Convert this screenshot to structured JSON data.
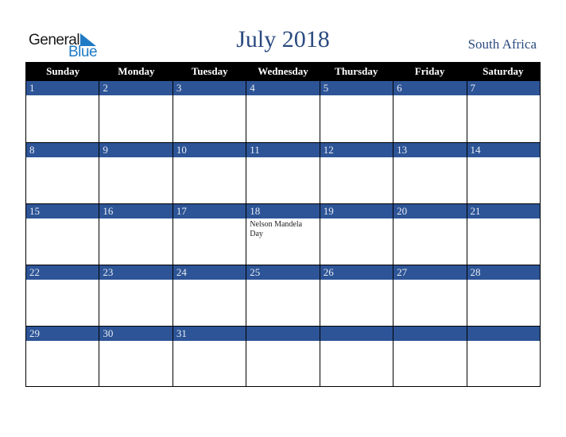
{
  "logo": {
    "line1": "General",
    "line2": "Blue",
    "brand_color": "#1f7ac4"
  },
  "title": "July 2018",
  "country": "South Africa",
  "colors": {
    "header_bg": "#000000",
    "date_bar": "#2d5496",
    "title": "#2b4a7f"
  },
  "weekdays": [
    "Sunday",
    "Monday",
    "Tuesday",
    "Wednesday",
    "Thursday",
    "Friday",
    "Saturday"
  ],
  "weeks": [
    [
      {
        "date": "1",
        "event": ""
      },
      {
        "date": "2",
        "event": ""
      },
      {
        "date": "3",
        "event": ""
      },
      {
        "date": "4",
        "event": ""
      },
      {
        "date": "5",
        "event": ""
      },
      {
        "date": "6",
        "event": ""
      },
      {
        "date": "7",
        "event": ""
      }
    ],
    [
      {
        "date": "8",
        "event": ""
      },
      {
        "date": "9",
        "event": ""
      },
      {
        "date": "10",
        "event": ""
      },
      {
        "date": "11",
        "event": ""
      },
      {
        "date": "12",
        "event": ""
      },
      {
        "date": "13",
        "event": ""
      },
      {
        "date": "14",
        "event": ""
      }
    ],
    [
      {
        "date": "15",
        "event": ""
      },
      {
        "date": "16",
        "event": ""
      },
      {
        "date": "17",
        "event": ""
      },
      {
        "date": "18",
        "event": "Nelson Mandela Day"
      },
      {
        "date": "19",
        "event": ""
      },
      {
        "date": "20",
        "event": ""
      },
      {
        "date": "21",
        "event": ""
      }
    ],
    [
      {
        "date": "22",
        "event": ""
      },
      {
        "date": "23",
        "event": ""
      },
      {
        "date": "24",
        "event": ""
      },
      {
        "date": "25",
        "event": ""
      },
      {
        "date": "26",
        "event": ""
      },
      {
        "date": "27",
        "event": ""
      },
      {
        "date": "28",
        "event": ""
      }
    ],
    [
      {
        "date": "29",
        "event": ""
      },
      {
        "date": "30",
        "event": ""
      },
      {
        "date": "31",
        "event": ""
      },
      {
        "date": "",
        "event": ""
      },
      {
        "date": "",
        "event": ""
      },
      {
        "date": "",
        "event": ""
      },
      {
        "date": "",
        "event": ""
      }
    ]
  ]
}
